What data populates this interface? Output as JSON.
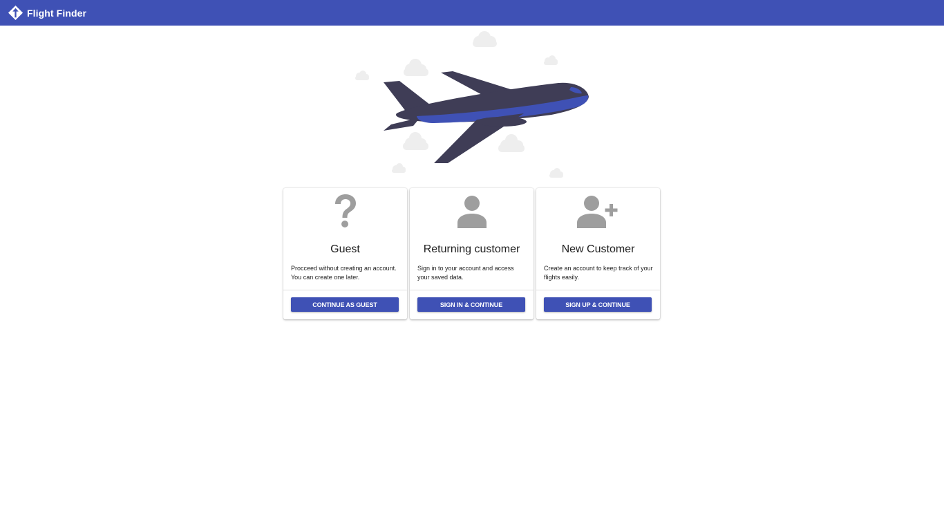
{
  "app": {
    "title": "Flight Finder",
    "brand_color": "#3f51b5"
  },
  "hero": {
    "illustration": "airplane-in-clouds",
    "plane_body_color": "#3f3d56",
    "plane_stripe_color": "#3f51b5"
  },
  "cards": [
    {
      "icon": "help-icon",
      "title": "Guest",
      "description": "Procceed without creating an account. You can create one later.",
      "button_label": "CONTINUE AS GUEST"
    },
    {
      "icon": "person-icon",
      "title": "Returning customer",
      "description": "Sign in to your account and access your saved data.",
      "button_label": "SIGN IN & CONTINUE"
    },
    {
      "icon": "person-add-icon",
      "title": "New Customer",
      "description": "Create an account to keep track of your flights easily.",
      "button_label": "SIGN UP & CONTINUE"
    }
  ]
}
